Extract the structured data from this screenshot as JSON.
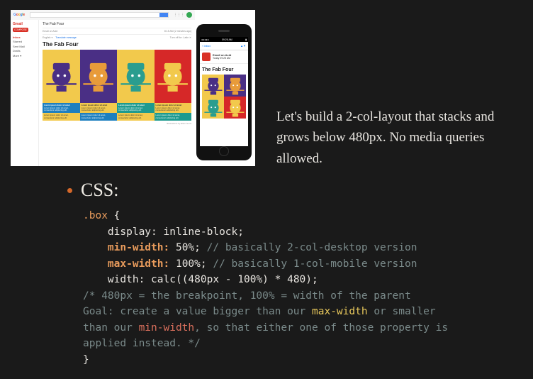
{
  "description": "Let's build a 2-col-layout that stacks and grows below 480px. No media queries allowed.",
  "bullet_label": "CSS:",
  "gmail": {
    "logo": "Gmail",
    "compose": "COMPOSE",
    "sidebar": [
      "Inbox",
      "Starred",
      "Sent Mail",
      "Drafts",
      "More ▾"
    ],
    "subject": "The Fab Four",
    "from": "Email on Acid",
    "timestamp": "8:15 AM (2 minutes ago)",
    "lang": "English ▾",
    "translate": "Translate message",
    "turn_off": "Turn off for: Latin ✕"
  },
  "email": {
    "title": "The Fab Four",
    "lorem_title": "Lorem ipsum dolor sit amet",
    "lorem_body": "Lorem ipsum dolor sit amet, consectetur adipiscing elit.",
    "credit": "Illustrations by Elton Gomi",
    "colors": {
      "ringo_bg": "#f2c94c",
      "ringo_face": "#4a2f85",
      "paul_bg": "#4a2f85",
      "paul_face": "#e89b3a",
      "john_bg": "#f2c94c",
      "john_face": "#2a9d8f",
      "george_bg": "#d62828",
      "george_face": "#f2c94c",
      "cap1_bg": "#1d7fbf",
      "cap2_bg": "#f2c94c",
      "cap3_bg": "#1d9a8f",
      "cap4_bg": "#f2c94c"
    }
  },
  "iphone": {
    "time": "09:26 AM",
    "nav_back": "Inbox",
    "from": "Email on Acid",
    "subject": "Today 09:25 AM"
  },
  "code": {
    "selector": ".box",
    "l1_prop": "display",
    "l1_val": "inline-block;",
    "l2_prop": "min-width:",
    "l2_val": "50%;",
    "l2_cmt": "// basically 2-col-desktop version",
    "l3_prop": "max-width:",
    "l3_val": "100%;",
    "l3_cmt": "// basically 1-col-mobile version",
    "l4_prop": "width",
    "l4_val": "calc((480px - 100%) * 480);",
    "block_cmt_1": "/* 480px = the breakpoint, 100% = width of the parent",
    "block_cmt_2a": "Goal: create a value bigger than our ",
    "block_cmt_2b": "max-width",
    "block_cmt_2c": " or smaller",
    "block_cmt_3a": "than our ",
    "block_cmt_3b": "min-width",
    "block_cmt_3c": ", so that either one of those property is",
    "block_cmt_4": "applied instead. */"
  }
}
